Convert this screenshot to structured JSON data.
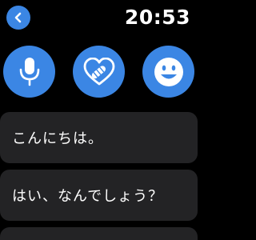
{
  "header": {
    "back_icon": "chevron-left-icon",
    "time": "20:53"
  },
  "actions": [
    {
      "name": "dictation",
      "icon": "microphone-icon"
    },
    {
      "name": "scribble",
      "icon": "heart-hand-icon"
    },
    {
      "name": "emoji",
      "icon": "smiley-icon"
    }
  ],
  "replies": [
    {
      "text": "こんにちは。"
    },
    {
      "text": "はい、なんでしょう？"
    },
    {
      "text": ""
    }
  ],
  "colors": {
    "accent": "#3b86e4",
    "card": "#232325",
    "background": "#000000"
  }
}
